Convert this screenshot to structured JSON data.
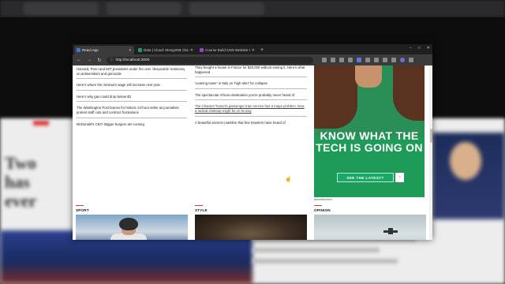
{
  "browser": {
    "tabs": [
      {
        "title": "React App",
        "active": true,
        "color": "#3a7bd5"
      },
      {
        "title": "Data | Cloud: MongoDB Cloud",
        "active": false,
        "color": "#18a058"
      },
      {
        "title": "Course Build CNN Website Cl...",
        "active": false,
        "color": "#a33ec7"
      }
    ],
    "new_tab": "+",
    "address": "http://localhost:3000",
    "window_controls": [
      "–",
      "□",
      "✕"
    ]
  },
  "page": {
    "column1": [
      "Harvard, Penn and MIT presidents under fire over 'despicable' testimony on antisemitism and genocide",
      "Here's where the minimum wage will increase next year",
      "Here's why gas could drop below $3",
      "The Washington Post braces for historic 24-hour strike as journalists protest staff cuts and contract frustrations",
      "McDonald's CEO: Bigger burgers are coming"
    ],
    "column2": [
      "They bought a house in France for $20,000 without seeing it. Here's what happened",
      "'Leaning tower' in Italy on 'high alert' for collapse",
      "The spectacular African destination you're probably never heard of",
      "The Channel Tunnel's passenger train service has a major problem. Now a radical shakeup might be on its way",
      "A beautiful ancient coastline that few travelers have heard of"
    ],
    "ad": {
      "headline_line1": "KNOW WHAT THE",
      "headline_line2": "TECH IS GOING ON",
      "cta": "SEE THE LATEST?",
      "cta_arrow": "›",
      "caption": "advertisement"
    },
    "sections": [
      "SPORT",
      "STYLE",
      "OPINION"
    ]
  },
  "colors": {
    "section_rule": "#dd3333",
    "ad_green": "#1e9b56"
  }
}
